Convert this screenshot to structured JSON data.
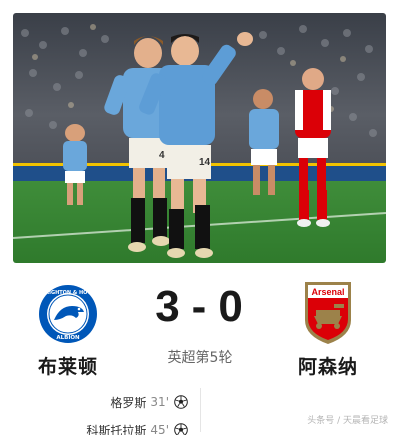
{
  "photo": {
    "description_icon": "celebration-photo",
    "players": [
      {
        "kit": "sky-blue",
        "number": "4"
      },
      {
        "kit": "sky-blue",
        "number": "14"
      },
      {
        "kit": "red-white",
        "number": ""
      }
    ]
  },
  "match": {
    "home_team": "布莱顿",
    "away_team": "阿森纳",
    "home_score": "3",
    "separator": "-",
    "away_score": "0",
    "round": "英超第5轮",
    "scorers": [
      {
        "name": "格罗斯",
        "minute": "31'"
      },
      {
        "name": "科斯托拉斯",
        "minute": "45'"
      }
    ]
  },
  "watermark": "头条号 / 天晨看足球",
  "colors": {
    "brighton_blue": "#0057b8",
    "arsenal_red": "#db0007",
    "arsenal_gold": "#9c824a",
    "text": "#1a1a1a",
    "muted": "#666666"
  },
  "icons": [
    "brighton-crest-icon",
    "arsenal-crest-icon",
    "football-icon"
  ]
}
